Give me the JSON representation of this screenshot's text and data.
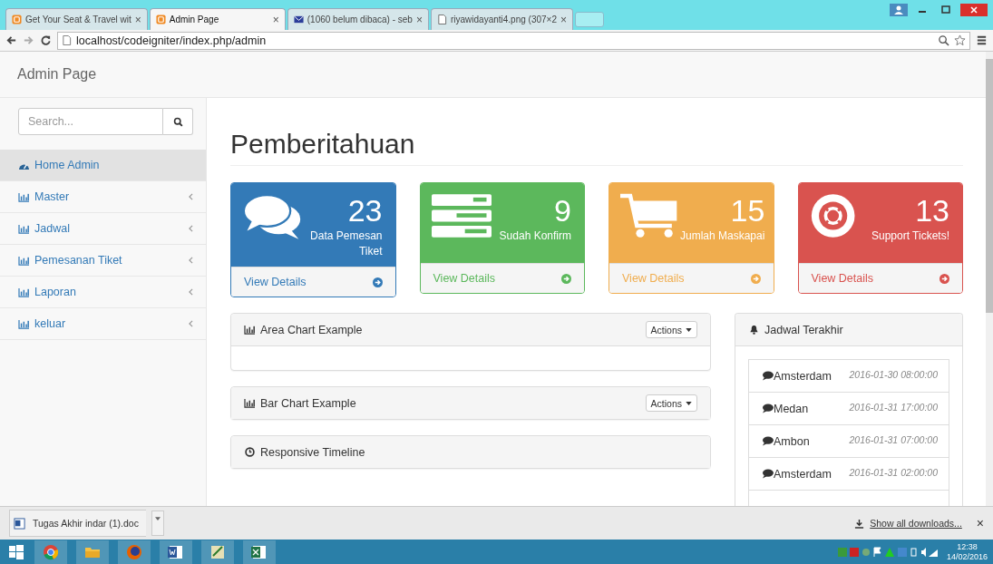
{
  "browser": {
    "tabs": [
      {
        "title": "Get Your Seat & Travel wit",
        "selected": false
      },
      {
        "title": "Admin Page",
        "selected": true
      },
      {
        "title": "(1060 belum dibaca) - seb",
        "selected": false
      },
      {
        "title": "riyawidayanti4.png (307×2",
        "selected": false
      }
    ],
    "close_glyph": "×",
    "url": "localhost/codeigniter/index.php/admin"
  },
  "navbar": {
    "brand": "Admin Page"
  },
  "sidebar": {
    "search": {
      "placeholder": "Search..."
    },
    "items": [
      {
        "label": "Home Admin",
        "selected": true,
        "has_submenu": false
      },
      {
        "label": "Master",
        "selected": false,
        "has_submenu": true
      },
      {
        "label": "Jadwal",
        "selected": false,
        "has_submenu": true
      },
      {
        "label": "Pemesanan Tiket",
        "selected": false,
        "has_submenu": true
      },
      {
        "label": "Laporan",
        "selected": false,
        "has_submenu": true
      },
      {
        "label": "keluar",
        "selected": false,
        "has_submenu": true
      }
    ]
  },
  "page_title": "Pemberitahuan",
  "stat_panels": [
    {
      "count": "23",
      "label": "Data Pemesan Tiket",
      "link": "View Details",
      "color": "#337ab7"
    },
    {
      "count": "9",
      "label": "Sudah Konfirm",
      "link": "View Details",
      "color": "#5cb85c"
    },
    {
      "count": "15",
      "label": "Jumlah Maskapai",
      "link": "View Details",
      "color": "#f0ad4e"
    },
    {
      "count": "13",
      "label": "Support Tickets!",
      "link": "View Details",
      "color": "#d9534f"
    }
  ],
  "panels": [
    {
      "title": "Area Chart Example",
      "action": "Actions",
      "has_body": true
    },
    {
      "title": "Bar Chart Example",
      "action": "Actions",
      "has_body": false
    },
    {
      "title": "Responsive Timeline",
      "has_body": false
    }
  ],
  "schedule": {
    "title": "Jadwal Terakhir",
    "items": [
      {
        "city": "Amsterdam",
        "time": "2016-01-30 08:00:00"
      },
      {
        "city": "Medan",
        "time": "2016-01-31 17:00:00"
      },
      {
        "city": "Ambon",
        "time": "2016-01-31 07:00:00"
      },
      {
        "city": "Amsterdam",
        "time": "2016-01-31 02:00:00"
      }
    ]
  },
  "download_bar": {
    "file": "Tugas Akhir indar (1).doc",
    "show_all": "Show all downloads...",
    "close": "×"
  },
  "taskbar": {
    "time": "12:38",
    "date": "14/02/2016"
  }
}
